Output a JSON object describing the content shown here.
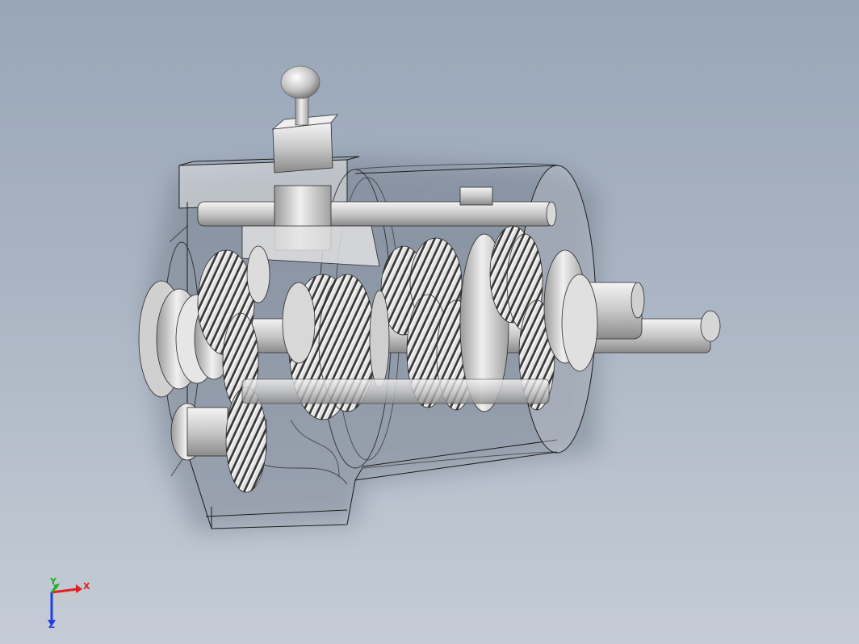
{
  "viewport": {
    "background_top": "#98a6b8",
    "background_bottom": "#c5ccd6"
  },
  "model": {
    "icon": "gearbox-assembly-3d",
    "housing_style": "transparent-wireframe",
    "part_color": "#d4d4d4",
    "edge_color": "#1a1a1a"
  },
  "triad": {
    "x_label": "X",
    "y_label": "Y",
    "z_label": "Z",
    "x_color": "#e02020",
    "y_color": "#20b020",
    "z_color": "#2040e0"
  }
}
